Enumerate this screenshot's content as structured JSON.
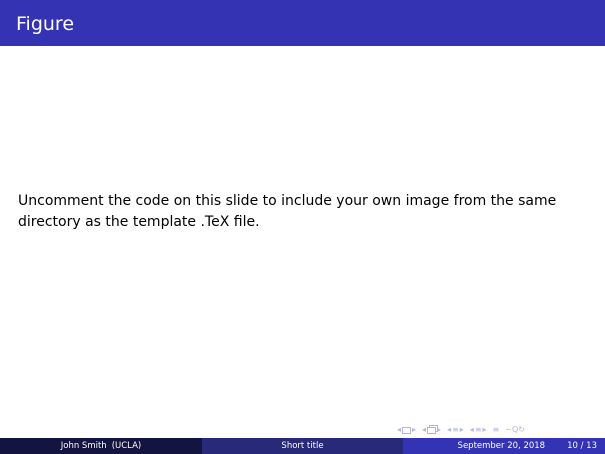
{
  "frame": {
    "title": "Figure"
  },
  "body": {
    "text": "Uncomment the code on this slide to include your own image from the same directory as the template .TeX file."
  },
  "footer": {
    "author": "John Smith",
    "institute": "(UCLA)",
    "short_title": "Short title",
    "date": "September 20, 2018",
    "page": "10 / 13"
  },
  "navigation": {
    "icons": [
      "nav-slide-icon",
      "nav-frame-icon",
      "nav-subsection-icon",
      "nav-section-icon",
      "nav-align-icon",
      "nav-search-icon"
    ],
    "colors": {
      "icon": "#b6b6dc"
    }
  },
  "colors": {
    "title_bar": "#3333b3",
    "foot_author": "#141440",
    "foot_title": "#29297a",
    "foot_date": "#3333b3",
    "text": "#000000"
  }
}
